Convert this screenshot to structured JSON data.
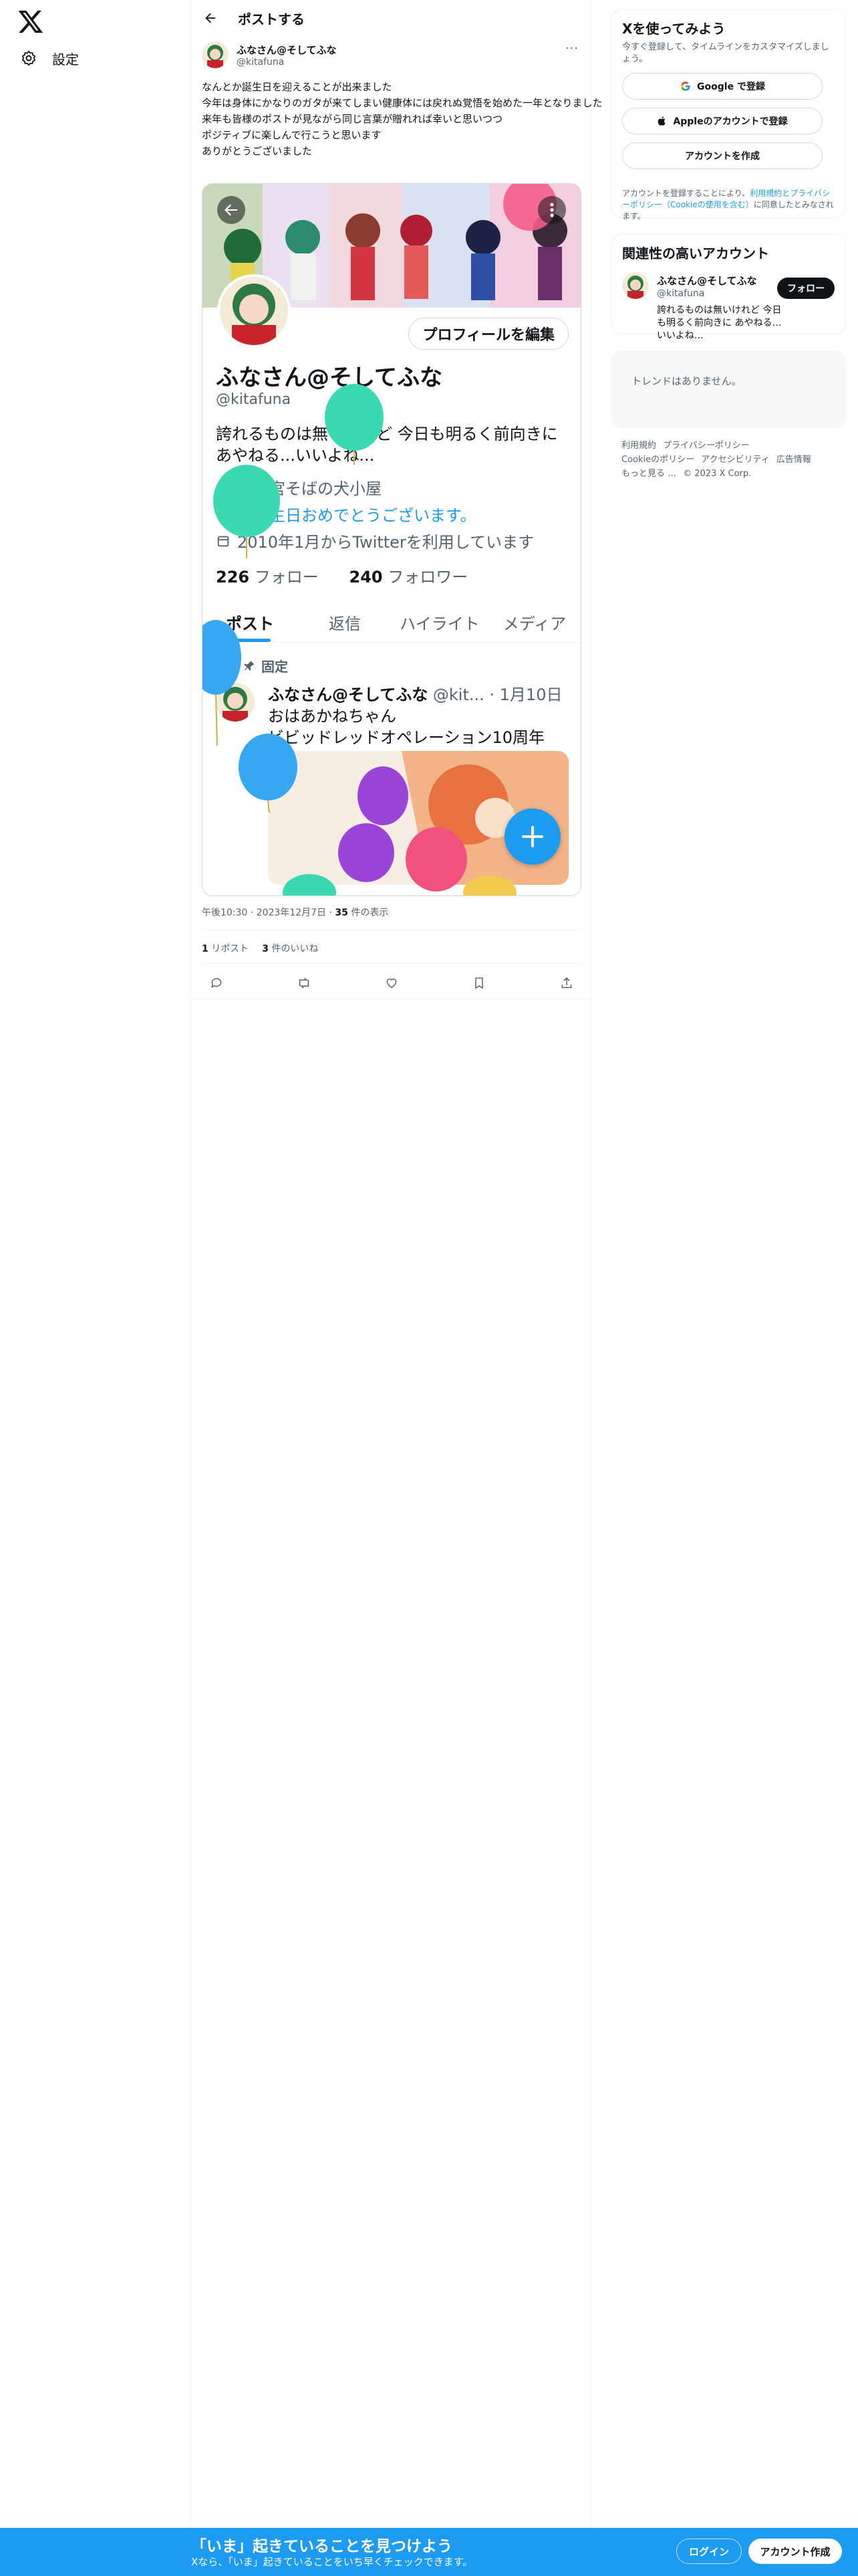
{
  "nav": {
    "settings_label": "設定",
    "logo_icon": "x-logo-icon"
  },
  "header": {
    "title": "ポストする"
  },
  "post": {
    "author_name": "ふなさん@そしてふな",
    "author_handle": "@kitafuna",
    "more": "···",
    "text_lines": [
      "なんとか誕生日を迎えることが出来ました",
      "今年は身体にかなりのガタが来てしまい健康体には戻れぬ覚悟を始めた一年となりました",
      "来年も皆様のポストが見ながら同じ言葉が贈れれば幸いと思いつつ",
      "ポジティブに楽しんで行こうと思います",
      "ありがとうございました"
    ],
    "timestamp": "午後10:30 · 2023年12月7日 · ",
    "views_count": "35",
    "views_label": " 件の表示",
    "reposts_count": "1",
    "reposts_label": " リポスト",
    "likes_count": "3",
    "likes_label": " 件のいいね"
  },
  "embed": {
    "edit_profile": "プロフィールを編集",
    "name": "ふなさん@そしてふな",
    "handle": "@kitafuna",
    "bio_lines": [
      "誇れるものは無いけれど 今日も明るく前向きに",
      "あやねる...いいよね..."
    ],
    "location": "八幡宮そばの犬小屋",
    "birthday_link": "お誕生日おめでとうございます。",
    "joined": "2010年1月からTwitterを利用しています",
    "following_count": "226",
    "following_label": " フォロー",
    "followers_count": "240",
    "followers_label": " フォロワー",
    "tabs": [
      "ポスト",
      "返信",
      "ハイライト",
      "メディア"
    ],
    "pinned_label": "固定",
    "tweet_name": "ふなさん@そしてふな",
    "tweet_handle_date": " @kit... · 1月10日",
    "tweet_line1": "おはあかねちゃん",
    "tweet_line2": "ビビッドレッドオペレーション10周年"
  },
  "sidebar": {
    "signup_title": "Xを使ってみよう",
    "signup_sub": "今すぐ登録して、タイムラインをカスタマイズしましょう。",
    "google_btn": "Google で登録",
    "apple_btn": "Appleのアカウントで登録",
    "create_btn": "アカウントを作成",
    "legal_prefix": "アカウントを登録することにより、",
    "legal_link": "利用規約とプライバシーポリシー（Cookieの使用を含む）",
    "legal_suffix": "に同意したとみなされます。",
    "related_title": "関連性の高いアカウント",
    "related_name": "ふなさん@そしてふな",
    "related_handle": "@kitafuna",
    "related_bio": "誇れるものは無いけれど 今日も明るく前向きに あやねる…いいよね…",
    "follow_btn": "フォロー",
    "trends_empty": "トレンドはありません。",
    "footer": [
      "利用規約",
      "プライバシーポリシー",
      "Cookieのポリシー",
      "アクセシビリティ",
      "広告情報",
      "もっと見る …",
      "© 2023 X Corp."
    ]
  },
  "bottombar": {
    "title": "「いま」起きていることを見つけよう",
    "subtitle": "Xなら、「いま」起きていることをいち早くチェックできます。",
    "login": "ログイン",
    "signup": "アカウント作成"
  },
  "colors": {
    "accent": "#1d9bf0",
    "text": "#0f1419",
    "muted": "#536471",
    "border": "#eff3f4"
  }
}
